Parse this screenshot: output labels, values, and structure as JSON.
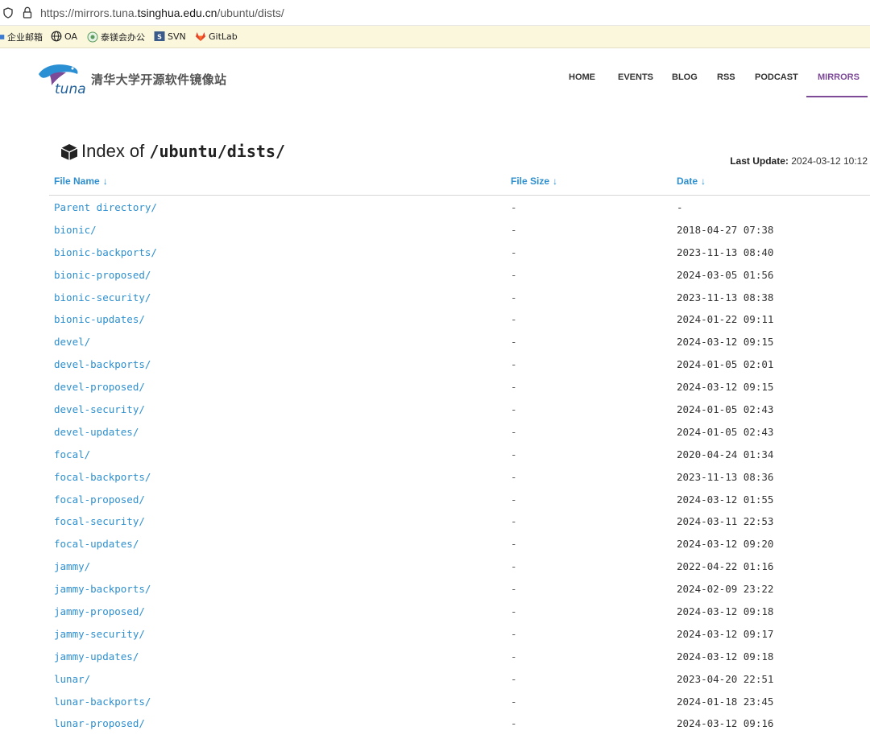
{
  "browser": {
    "url_prefix": "https://mirrors.tuna.",
    "url_host": "tsinghua.edu.cn",
    "url_path": "/ubuntu/dists/"
  },
  "bookmarks": [
    {
      "label": "企业邮箱",
      "icon": "mail-icon"
    },
    {
      "label": "OA",
      "icon": "globe-icon"
    },
    {
      "label": "泰镁会办公",
      "icon": "office-icon"
    },
    {
      "label": "SVN",
      "icon": "svn-icon"
    },
    {
      "label": "GitLab",
      "icon": "gitlab-icon"
    }
  ],
  "header": {
    "logo_text": "tuna",
    "site_title": "清华大学开源软件镜像站",
    "nav": [
      {
        "label": "HOME",
        "active": false
      },
      {
        "label": "EVENTS",
        "active": false
      },
      {
        "label": "BLOG",
        "active": false
      },
      {
        "label": "RSS",
        "active": false
      },
      {
        "label": "PODCAST",
        "active": false
      },
      {
        "label": "MIRRORS",
        "active": true
      }
    ]
  },
  "index": {
    "title_prefix": "Index of",
    "title_path": "/ubuntu/dists/",
    "last_update_label": "Last Update:",
    "last_update_value": "2024-03-12 10:12"
  },
  "table": {
    "headers": {
      "name": "File Name",
      "size": "File Size",
      "date": "Date",
      "sort_arrow": "↓"
    },
    "rows": [
      {
        "name": "Parent directory/",
        "size": "-",
        "date": "-"
      },
      {
        "name": "bionic/",
        "size": "-",
        "date": "2018-04-27 07:38"
      },
      {
        "name": "bionic-backports/",
        "size": "-",
        "date": "2023-11-13 08:40"
      },
      {
        "name": "bionic-proposed/",
        "size": "-",
        "date": "2024-03-05 01:56"
      },
      {
        "name": "bionic-security/",
        "size": "-",
        "date": "2023-11-13 08:38"
      },
      {
        "name": "bionic-updates/",
        "size": "-",
        "date": "2024-01-22 09:11"
      },
      {
        "name": "devel/",
        "size": "-",
        "date": "2024-03-12 09:15"
      },
      {
        "name": "devel-backports/",
        "size": "-",
        "date": "2024-01-05 02:01"
      },
      {
        "name": "devel-proposed/",
        "size": "-",
        "date": "2024-03-12 09:15"
      },
      {
        "name": "devel-security/",
        "size": "-",
        "date": "2024-01-05 02:43"
      },
      {
        "name": "devel-updates/",
        "size": "-",
        "date": "2024-01-05 02:43"
      },
      {
        "name": "focal/",
        "size": "-",
        "date": "2020-04-24 01:34"
      },
      {
        "name": "focal-backports/",
        "size": "-",
        "date": "2023-11-13 08:36"
      },
      {
        "name": "focal-proposed/",
        "size": "-",
        "date": "2024-03-12 01:55"
      },
      {
        "name": "focal-security/",
        "size": "-",
        "date": "2024-03-11 22:53"
      },
      {
        "name": "focal-updates/",
        "size": "-",
        "date": "2024-03-12 09:20"
      },
      {
        "name": "jammy/",
        "size": "-",
        "date": "2022-04-22 01:16"
      },
      {
        "name": "jammy-backports/",
        "size": "-",
        "date": "2024-02-09 23:22"
      },
      {
        "name": "jammy-proposed/",
        "size": "-",
        "date": "2024-03-12 09:18"
      },
      {
        "name": "jammy-security/",
        "size": "-",
        "date": "2024-03-12 09:17"
      },
      {
        "name": "jammy-updates/",
        "size": "-",
        "date": "2024-03-12 09:18"
      },
      {
        "name": "lunar/",
        "size": "-",
        "date": "2023-04-20 22:51"
      },
      {
        "name": "lunar-backports/",
        "size": "-",
        "date": "2024-01-18 23:45"
      },
      {
        "name": "lunar-proposed/",
        "size": "-",
        "date": "2024-03-12 09:16"
      }
    ]
  },
  "colors": {
    "link": "#2d8fcf",
    "accent": "#7d4a98",
    "bookmark_bar": "#fbf7dc"
  }
}
